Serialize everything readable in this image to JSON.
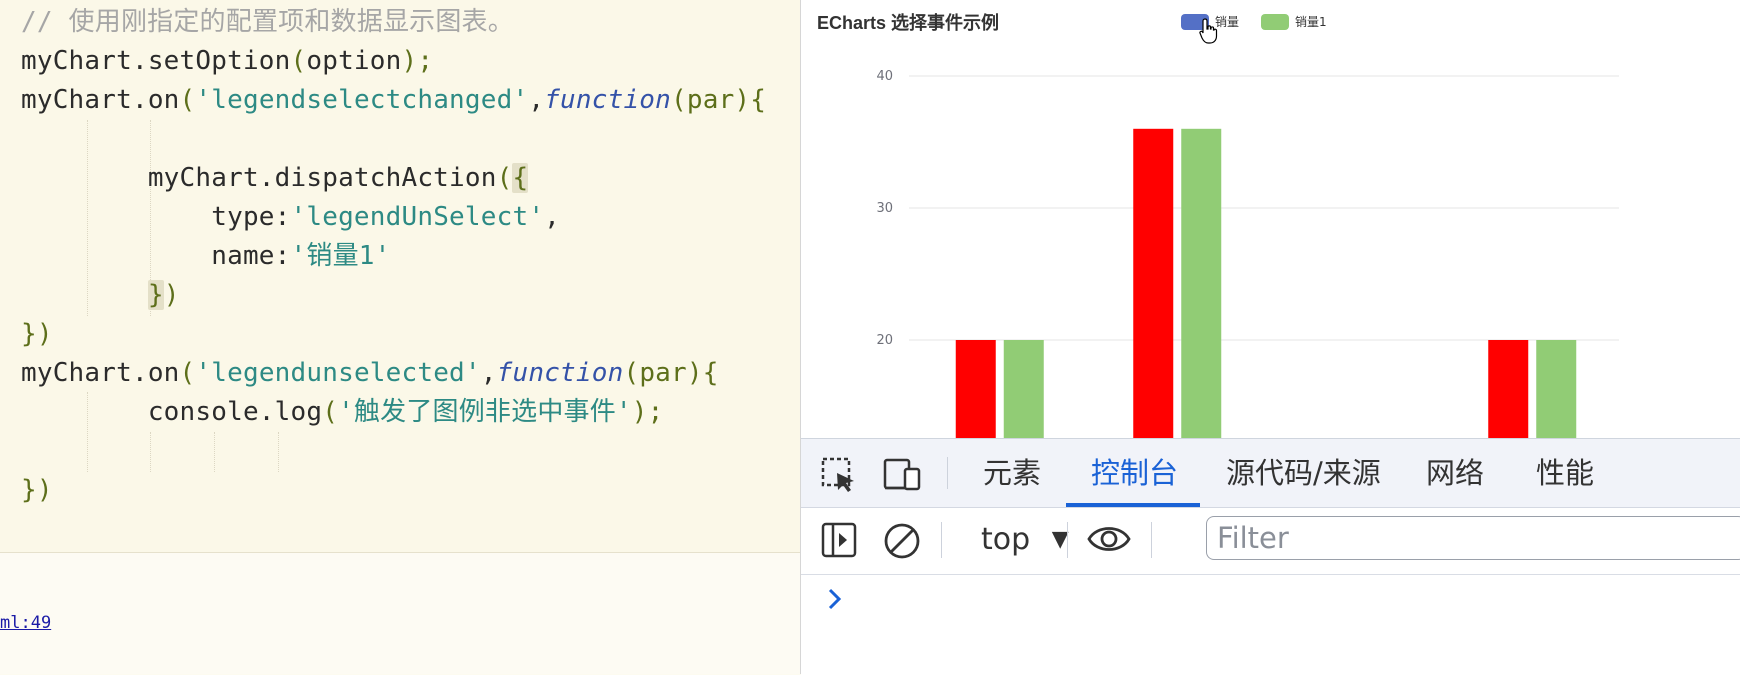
{
  "editor": {
    "lines": [
      {
        "parts": [
          {
            "t": "// 使用刚指定的配置项和数据显示图表。",
            "c": "c-comment"
          }
        ]
      },
      {
        "parts": [
          {
            "t": "myChart.setOption",
            "c": ""
          },
          {
            "t": "(",
            "c": "c-punct"
          },
          {
            "t": "option",
            "c": ""
          },
          {
            "t": ");",
            "c": "c-punct"
          }
        ]
      },
      {
        "parts": [
          {
            "t": "myChart.on",
            "c": ""
          },
          {
            "t": "(",
            "c": "c-punct"
          },
          {
            "t": "'legendselectchanged'",
            "c": "c-str"
          },
          {
            "t": ",",
            "c": ""
          },
          {
            "t": "function",
            "c": "c-kw"
          },
          {
            "t": "(par){",
            "c": "c-punct"
          }
        ]
      },
      {
        "parts": [
          {
            "t": "",
            "c": ""
          }
        ]
      },
      {
        "parts": [
          {
            "t": "        myChart.dispatchAction",
            "c": ""
          },
          {
            "t": "(",
            "c": "c-punct"
          },
          {
            "t": "{",
            "c": "c-punct c-hl"
          }
        ]
      },
      {
        "parts": [
          {
            "t": "            type:",
            "c": ""
          },
          {
            "t": "'legendUnSelect'",
            "c": "c-str"
          },
          {
            "t": ",",
            "c": ""
          }
        ]
      },
      {
        "parts": [
          {
            "t": "            name:",
            "c": ""
          },
          {
            "t": "'销量1'",
            "c": "c-str"
          }
        ]
      },
      {
        "parts": [
          {
            "t": "        ",
            "c": ""
          },
          {
            "t": "}",
            "c": "c-punct c-hl"
          },
          {
            "t": ")",
            "c": "c-punct"
          }
        ]
      },
      {
        "parts": [
          {
            "t": "})",
            "c": "c-punct"
          }
        ]
      },
      {
        "parts": [
          {
            "t": "myChart.on",
            "c": ""
          },
          {
            "t": "(",
            "c": "c-punct"
          },
          {
            "t": "'legendunselected'",
            "c": "c-str"
          },
          {
            "t": ",",
            "c": ""
          },
          {
            "t": "function",
            "c": "c-kw"
          },
          {
            "t": "(par){",
            "c": "c-punct"
          }
        ]
      },
      {
        "parts": [
          {
            "t": "        console.log",
            "c": ""
          },
          {
            "t": "(",
            "c": "c-punct"
          },
          {
            "t": "'触发了图例非选中事件'",
            "c": "c-str"
          },
          {
            "t": ");",
            "c": "c-punct"
          }
        ]
      },
      {
        "parts": [
          {
            "t": "",
            "c": ""
          }
        ]
      },
      {
        "parts": [
          {
            "t": "})",
            "c": "c-punct"
          }
        ]
      }
    ],
    "file_link": "ml:49"
  },
  "chart_data": {
    "type": "bar",
    "title": "ECharts 选择事件示例",
    "legend": [
      "销量",
      "销量1"
    ],
    "legend_placement": "top-center",
    "y_ticks": [
      20,
      30,
      40
    ],
    "ylim": [
      0,
      40
    ],
    "grid": true,
    "series": [
      {
        "name": "销量",
        "color": "#ff0000",
        "values": [
          20,
          36,
          null,
          20
        ]
      },
      {
        "name": "销量1",
        "color": "#91cc75",
        "values": [
          20,
          36,
          null,
          20
        ]
      }
    ],
    "legend_colors": [
      "#5470c6",
      "#91cc75"
    ]
  },
  "devtools": {
    "tabs": [
      "元素",
      "控制台",
      "源代码/来源",
      "网络",
      "性能"
    ],
    "active_tab": 1,
    "context": "top",
    "filter_placeholder": "Filter",
    "prompt": "›"
  }
}
